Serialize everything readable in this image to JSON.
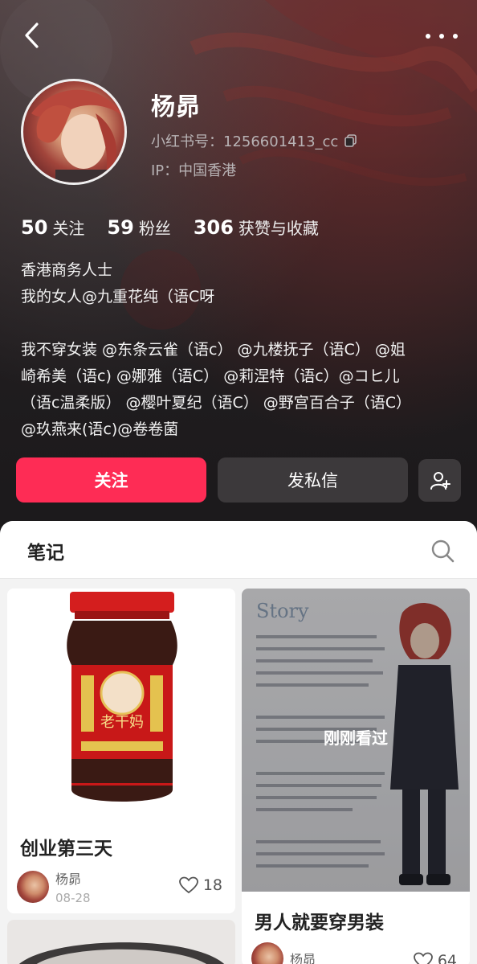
{
  "profile": {
    "name": "杨昴",
    "rid": "小红书号：1256601413_cc",
    "ip": "IP：中国香港"
  },
  "stats": [
    {
      "num": "50",
      "label": "关注"
    },
    {
      "num": "59",
      "label": "粉丝"
    },
    {
      "num": "306",
      "label": "获赞与收藏"
    }
  ],
  "bio": {
    "line1": "香港商务人士",
    "line2": "我的女人@九重花纯（语C呀",
    "line3": "我不穿女装 @东条云雀（语c） @九楼抚子（语C） @姐",
    "line4": "崎希美（语c) @娜雅（语C） @莉涅特（语c）@コヒ儿",
    "line5": "（语c温柔版） @樱叶夏纪（语C） @野宫百合子（语C）",
    "line6": "@玖燕来(语c)@卷卷菌"
  },
  "actions": {
    "follow": "关注",
    "message": "发私信"
  },
  "tabs": {
    "notes": "笔记"
  },
  "notes": [
    {
      "title": "创业第三天",
      "author": "杨昴",
      "date": "08-28",
      "likes": "18"
    },
    {
      "title": "男人就要穿男装",
      "author": "杨昴",
      "likes": "64",
      "overlay": "刚刚看过",
      "cover_heading": "Story"
    }
  ],
  "colors": {
    "accent": "#fe2c55",
    "secondary_button": "#3c393b"
  },
  "icons": [
    "back-icon",
    "more-icon",
    "copy-icon",
    "add-user-icon",
    "search-icon",
    "heart-icon"
  ]
}
